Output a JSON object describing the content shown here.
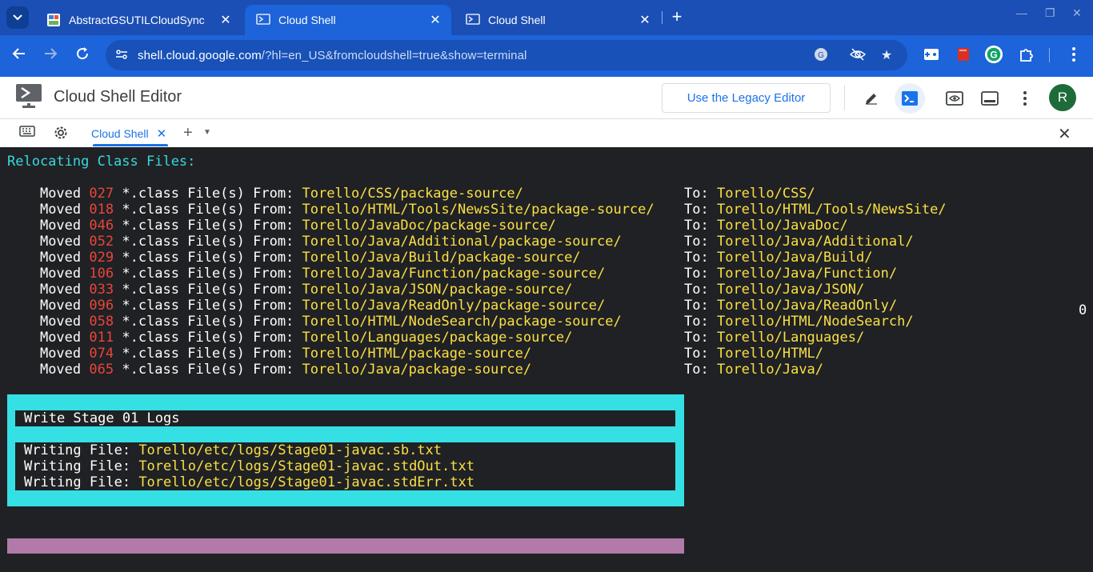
{
  "browser": {
    "tabs": [
      {
        "title": "AbstractGSUTILCloudSync",
        "active": false
      },
      {
        "title": "Cloud Shell",
        "active": true
      },
      {
        "title": "Cloud Shell",
        "active": false
      }
    ],
    "url_host": "shell.cloud.google.com",
    "url_path": "/?hl=en_US&fromcloudshell=true&show=terminal"
  },
  "header": {
    "title": "Cloud Shell Editor",
    "legacy_button": "Use the Legacy Editor",
    "avatar_initial": "R"
  },
  "terminal_tabs": {
    "active_tab": "Cloud Shell"
  },
  "terminal": {
    "heading": "Relocating Class Files:",
    "moved_label": "Moved",
    "files_label": "*.class File(s) From:",
    "to_label": "To:",
    "rows": [
      {
        "count": "027",
        "from": "Torello/CSS/package-source/",
        "to": "Torello/CSS/"
      },
      {
        "count": "018",
        "from": "Torello/HTML/Tools/NewsSite/package-source/",
        "to": "Torello/HTML/Tools/NewsSite/"
      },
      {
        "count": "046",
        "from": "Torello/JavaDoc/package-source/",
        "to": "Torello/JavaDoc/"
      },
      {
        "count": "052",
        "from": "Torello/Java/Additional/package-source/",
        "to": "Torello/Java/Additional/"
      },
      {
        "count": "029",
        "from": "Torello/Java/Build/package-source/",
        "to": "Torello/Java/Build/"
      },
      {
        "count": "106",
        "from": "Torello/Java/Function/package-source/",
        "to": "Torello/Java/Function/"
      },
      {
        "count": "033",
        "from": "Torello/Java/JSON/package-source/",
        "to": "Torello/Java/JSON/"
      },
      {
        "count": "096",
        "from": "Torello/Java/ReadOnly/package-source/",
        "to": "Torello/Java/ReadOnly/"
      },
      {
        "count": "058",
        "from": "Torello/HTML/NodeSearch/package-source/",
        "to": "Torello/HTML/NodeSearch/"
      },
      {
        "count": "011",
        "from": "Torello/Languages/package-source/",
        "to": "Torello/Languages/"
      },
      {
        "count": "074",
        "from": "Torello/HTML/package-source/",
        "to": "Torello/HTML/"
      },
      {
        "count": "065",
        "from": "Torello/Java/package-source/",
        "to": "Torello/Java/"
      }
    ],
    "side_value": "0",
    "stage": {
      "title": "Write Stage 01 Logs",
      "writing_label": "Writing File:",
      "files": [
        "Torello/etc/logs/Stage01-javac.sb.txt",
        "Torello/etc/logs/Stage01-javac.stdOut.txt",
        "Torello/etc/logs/Stage01-javac.stdErr.txt"
      ]
    }
  },
  "colors": {
    "terminal_bg": "#202124",
    "cyan": "#37d9de",
    "red": "#e8453c",
    "yellow": "#f8e045",
    "purple_bar": "#b27aa8",
    "accent": "#1a73e8"
  }
}
